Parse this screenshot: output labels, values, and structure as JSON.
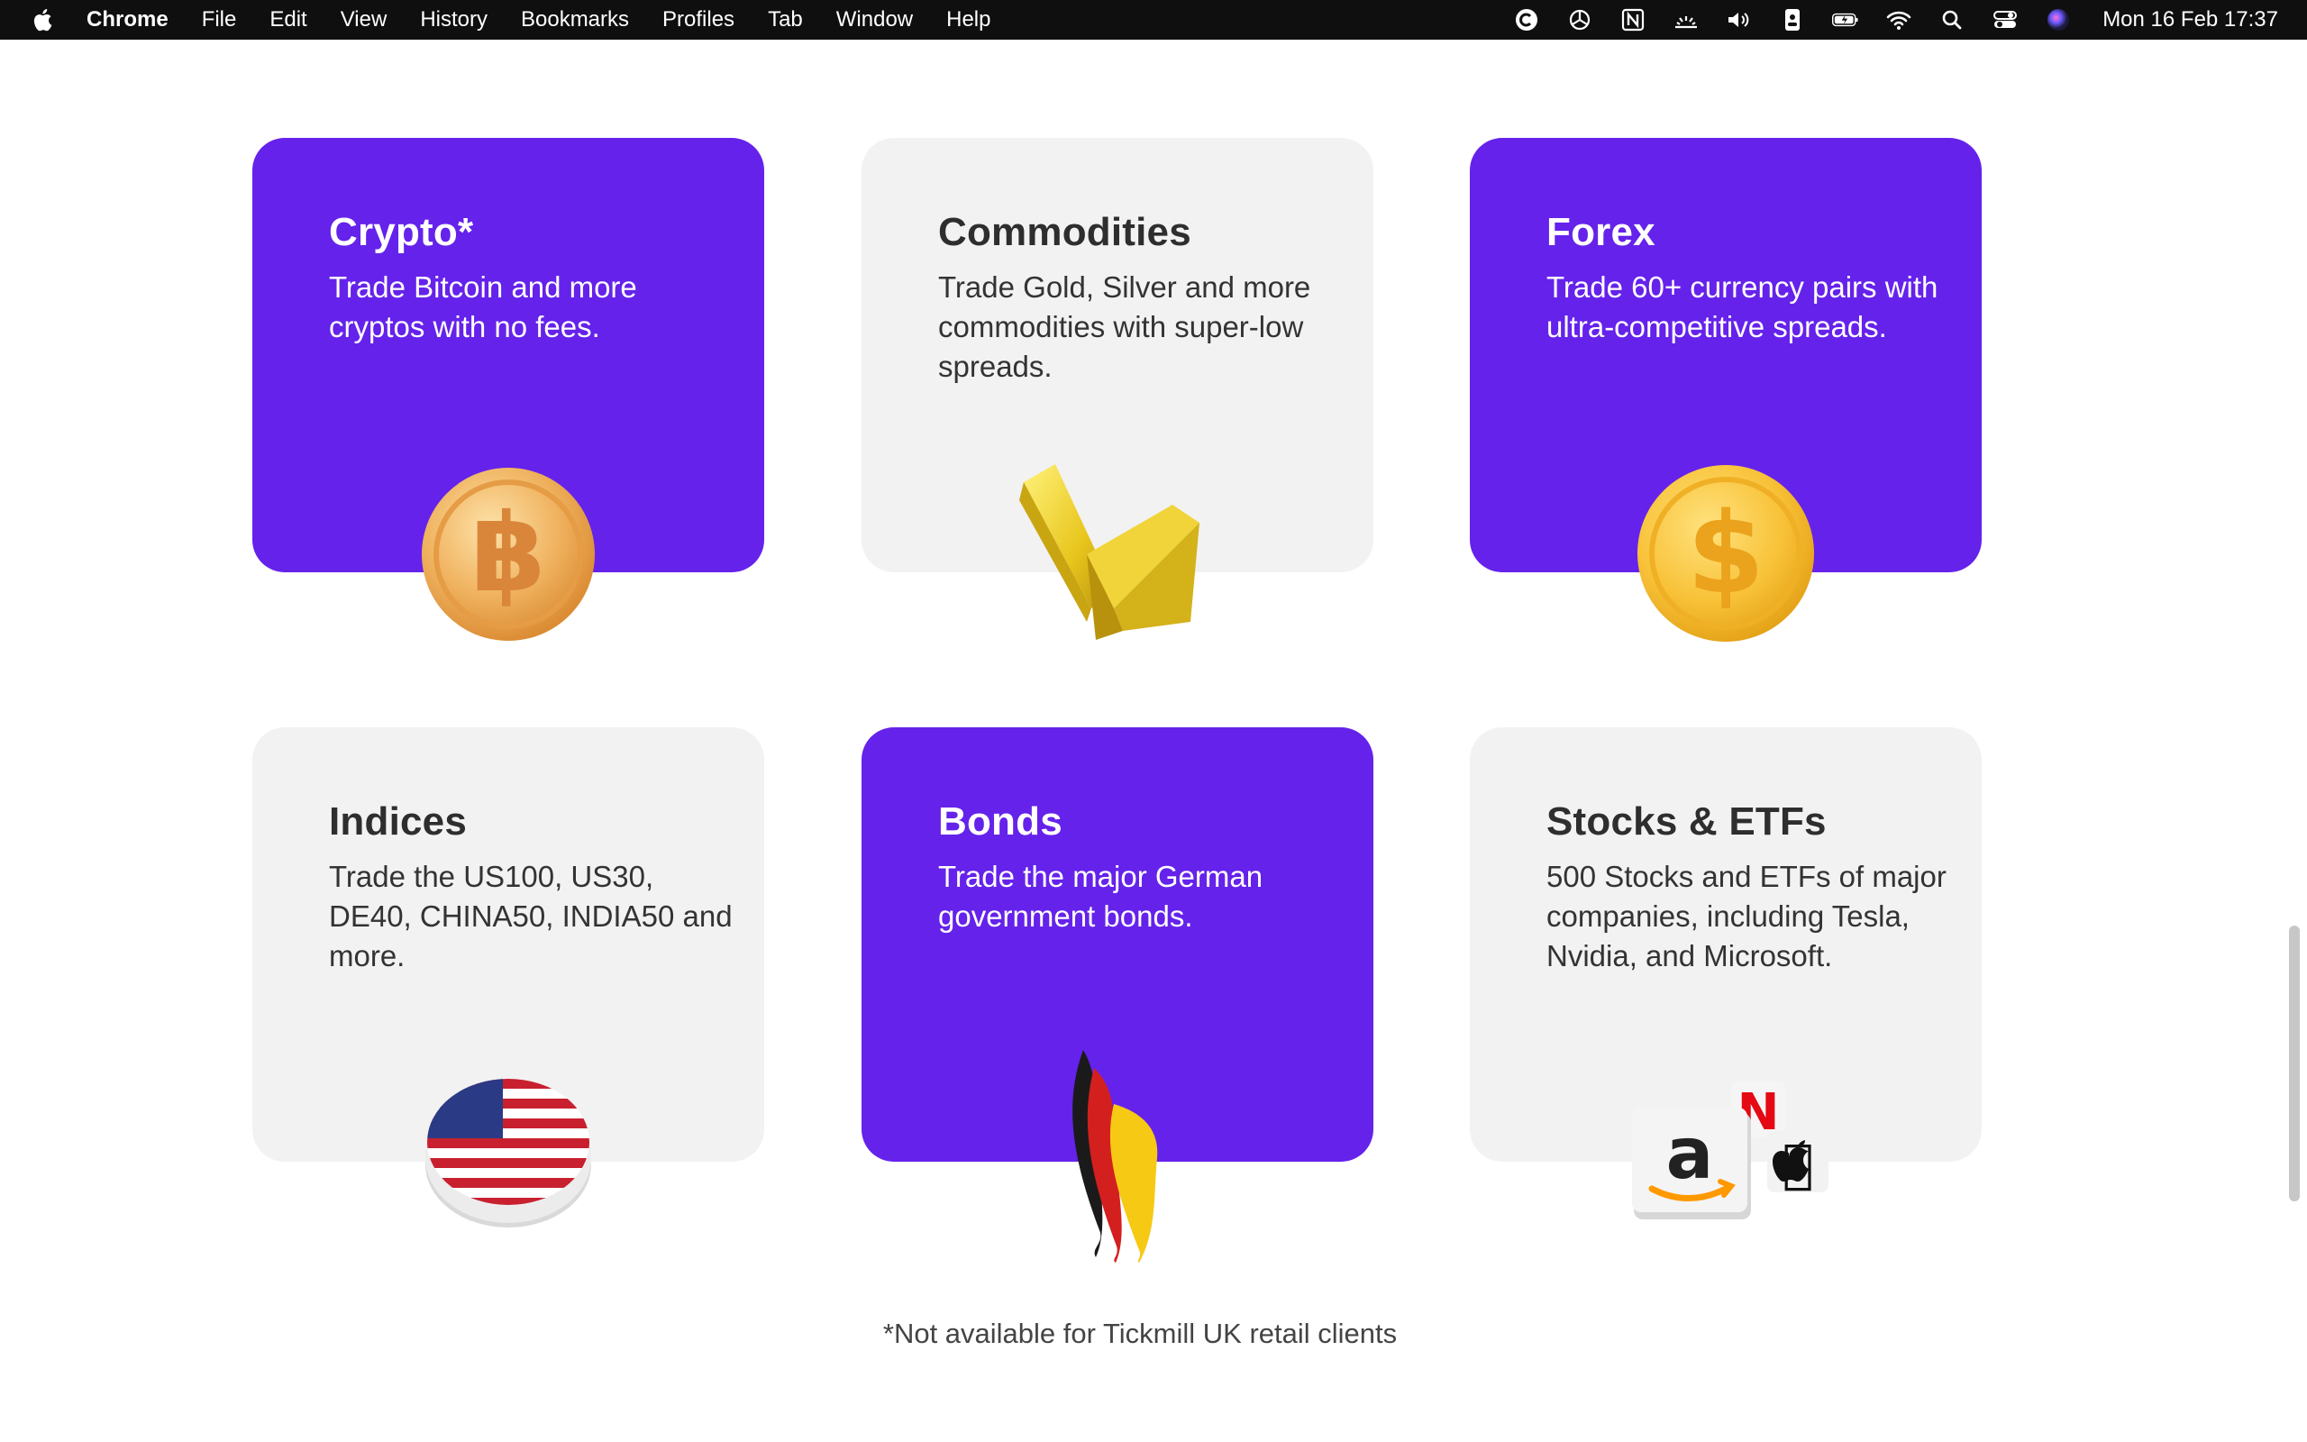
{
  "menubar": {
    "app_name": "Chrome",
    "items": [
      "File",
      "Edit",
      "View",
      "History",
      "Bookmarks",
      "Profiles",
      "Tab",
      "Window",
      "Help"
    ],
    "clock": "Mon 16 Feb  17:37",
    "status_icons": [
      "c-circle-icon",
      "openai-icon",
      "notion-icon",
      "brightness-icon",
      "volume-icon",
      "badge-icon",
      "battery-icon",
      "wifi-icon",
      "search-icon",
      "control-center-icon",
      "siri-icon"
    ]
  },
  "cards": [
    {
      "title": "Crypto*",
      "text": "Trade Bitcoin and more cryptos with no fees.",
      "style": "purple",
      "icon": "bitcoin-coin-icon"
    },
    {
      "title": "Commodities",
      "text": "Trade Gold, Silver and more commodities with super-low spreads.",
      "style": "grey",
      "icon": "gold-bars-icon"
    },
    {
      "title": "Forex",
      "text": "Trade 60+ currency pairs with ultra-competitive spreads.",
      "style": "purple",
      "icon": "dollar-coin-icon"
    },
    {
      "title": "Indices",
      "text": "Trade the US100, US30, DE40, CHINA50, INDIA50 and more.",
      "style": "grey",
      "icon": "us-flag-button-icon"
    },
    {
      "title": "Bonds",
      "text": "Trade the major German government bonds.",
      "style": "purple",
      "icon": "german-flag-ribbon-icon"
    },
    {
      "title": "Stocks & ETFs",
      "text": "500 Stocks and ETFs of major companies, including Tesla, Nvidia, and Microsoft.",
      "style": "grey",
      "icon": "stock-logos-icon"
    }
  ],
  "footnote": "*Not available for Tickmill UK retail clients",
  "colors": {
    "purple": "#6522eb",
    "grey_card": "#f2f2f2",
    "gold": "#f2b640"
  }
}
